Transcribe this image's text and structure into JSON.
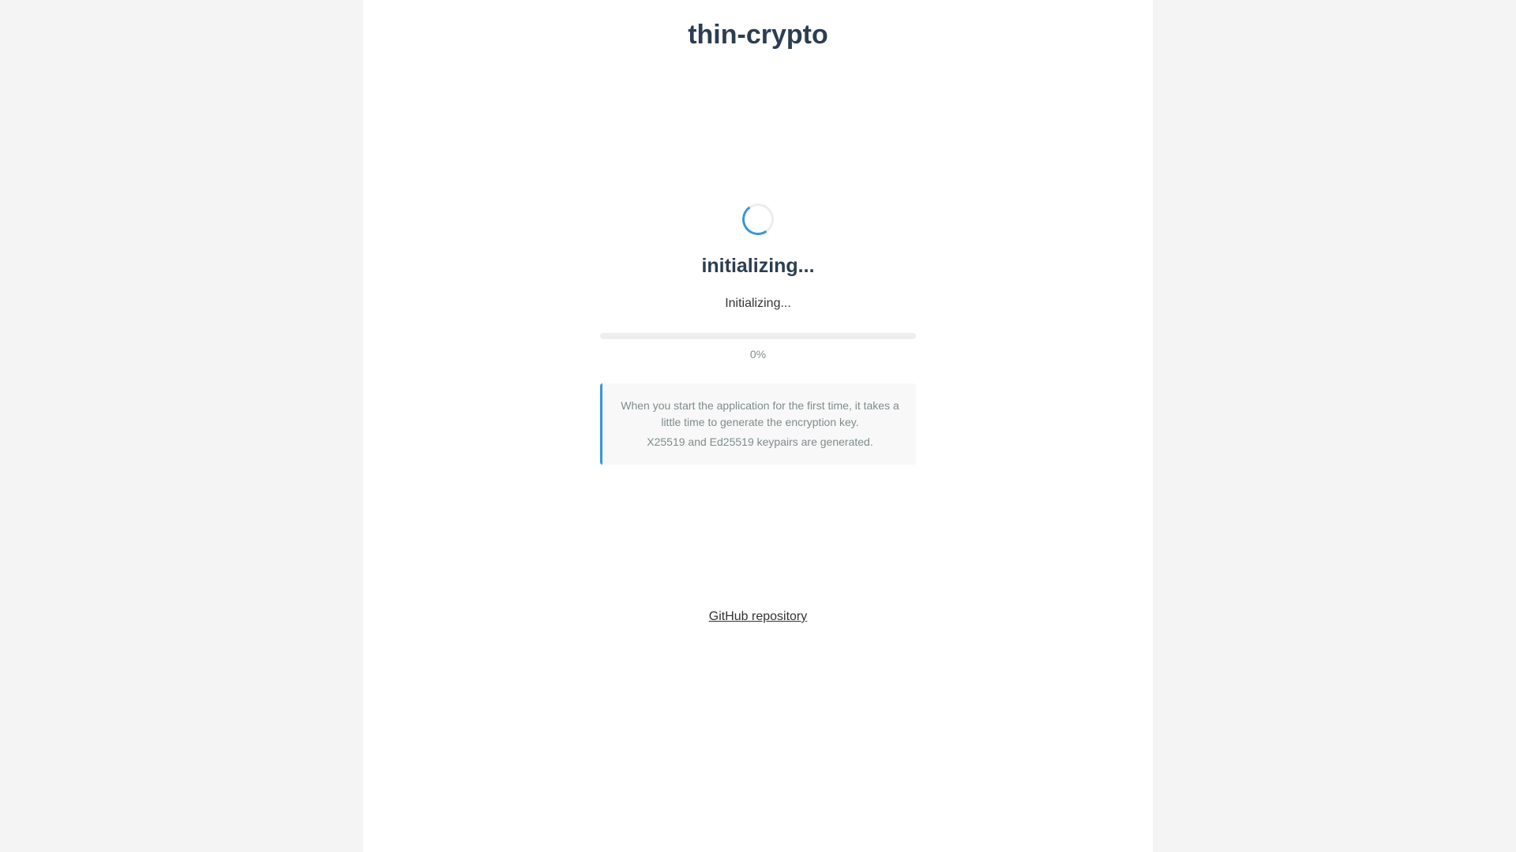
{
  "app": {
    "title": "thin-crypto"
  },
  "loader": {
    "icon": "spinner-icon",
    "heading": "initializing...",
    "status": "Initializing...",
    "progress": 0,
    "progress_label": "0%"
  },
  "info": {
    "line1": "When you start the application for the first time, it takes a little time to generate the encryption key.",
    "line2": "X25519 and Ed25519 keypairs are generated."
  },
  "footer": {
    "link_label": "GitHub repository"
  },
  "colors": {
    "accent": "#3498db",
    "heading": "#2c3e50",
    "muted": "#7f8c8d",
    "background": "#f4f4f4",
    "panel": "#ffffff"
  }
}
